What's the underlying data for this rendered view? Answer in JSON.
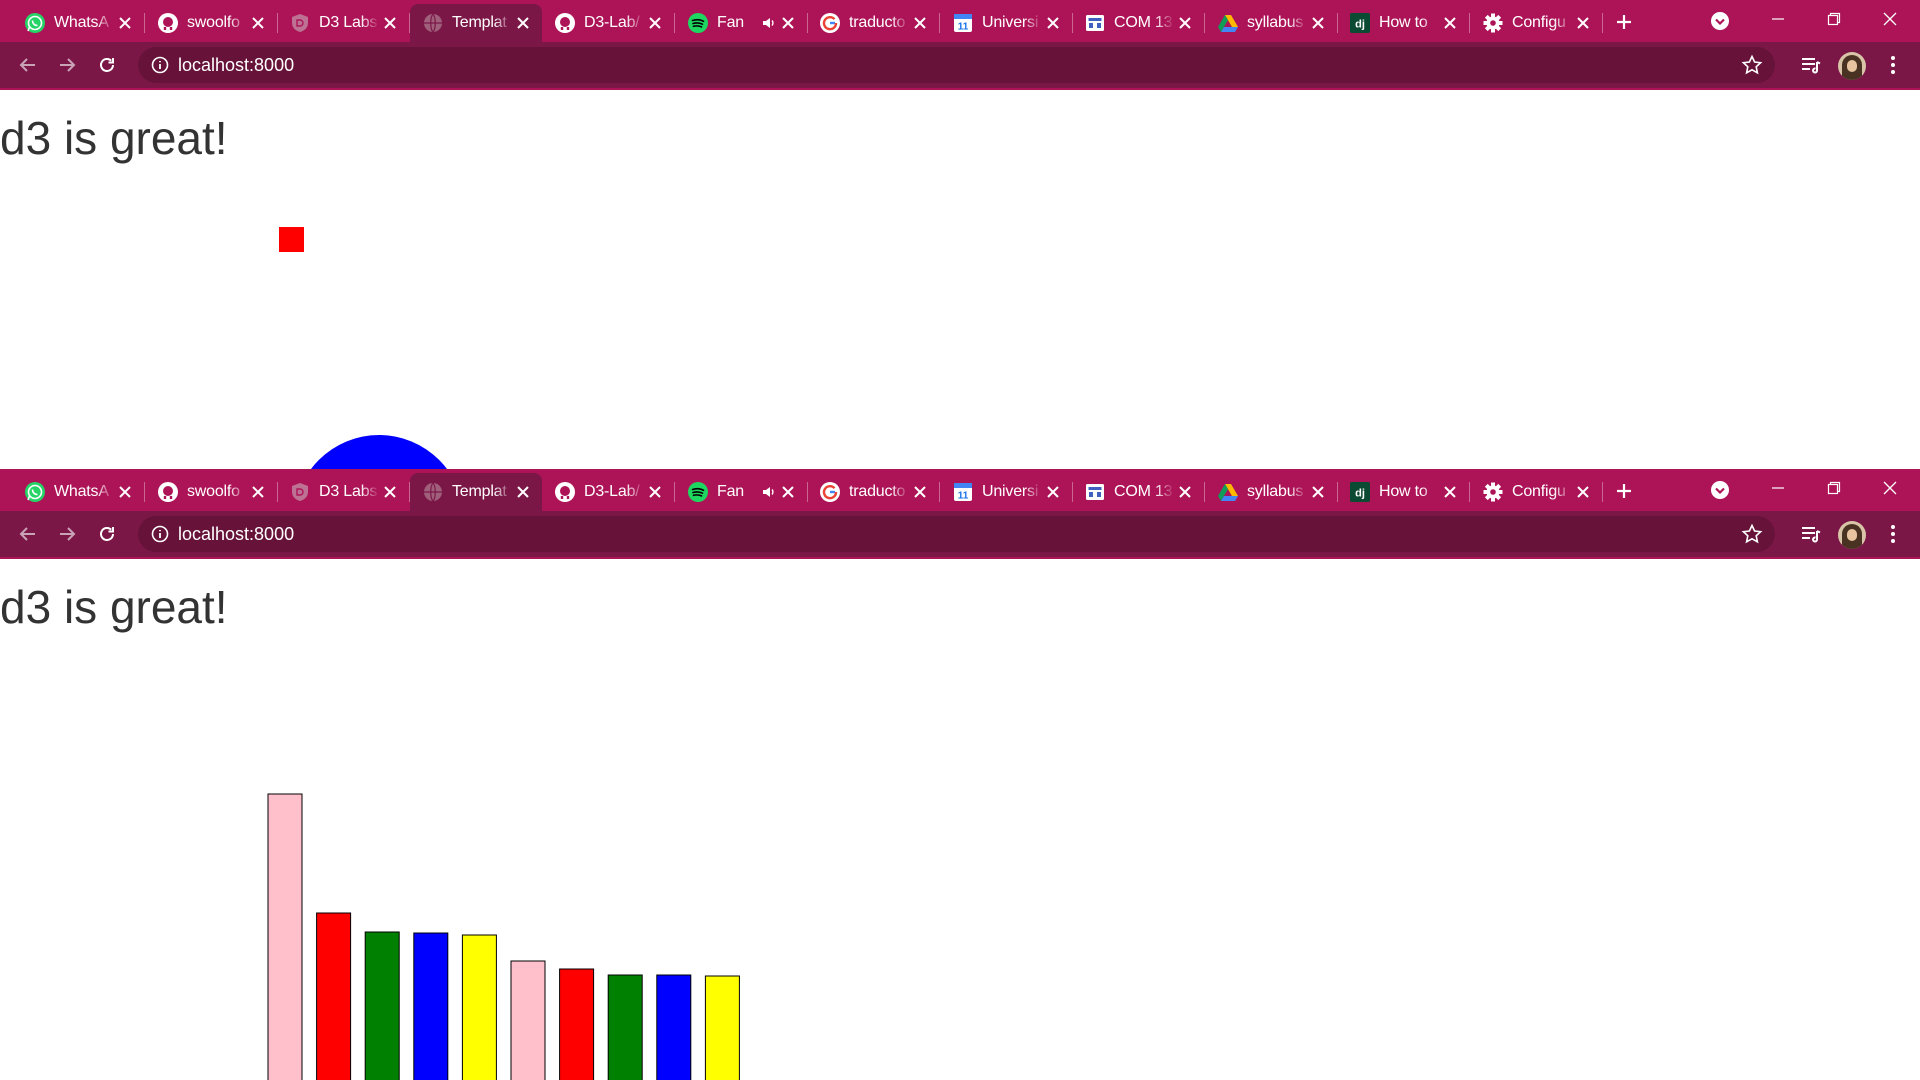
{
  "colors": {
    "tab_strip": "#ad1457",
    "toolbar": "#7b1747",
    "omnibox": "#661239",
    "page_bg": "#ffffff",
    "heading_text": "#333333"
  },
  "browser": {
    "tabs": [
      {
        "title": "WhatsA",
        "icon": "whatsapp-icon",
        "active": false
      },
      {
        "title": "swoolfo",
        "icon": "github-icon",
        "active": false
      },
      {
        "title": "D3 Labs",
        "icon": "d3-shield-icon",
        "active": false
      },
      {
        "title": "Templat",
        "icon": "globe-icon",
        "active": true
      },
      {
        "title": "D3-Lab/",
        "icon": "github-icon",
        "active": false
      },
      {
        "title": "Fan",
        "icon": "spotify-icon",
        "active": false,
        "audio": true
      },
      {
        "title": "traducto",
        "icon": "google-icon",
        "active": false
      },
      {
        "title": "Universi",
        "icon": "calendar-icon",
        "active": false
      },
      {
        "title": "COM 13",
        "icon": "classroom-icon",
        "active": false
      },
      {
        "title": "syllabus",
        "icon": "google-drive-icon",
        "active": false
      },
      {
        "title": "How to",
        "icon": "django-icon",
        "active": false
      },
      {
        "title": "Configu",
        "icon": "settings-gear-icon",
        "active": false
      }
    ],
    "url": "localhost:8000"
  },
  "page": {
    "heading": "d3 is great!"
  },
  "shapes": {
    "square_color": "#ff0000",
    "circle_color": "#0000ff"
  },
  "chart_data": {
    "type": "bar",
    "title": "",
    "xlabel": "",
    "ylabel": "",
    "values": [
      287,
      168,
      149,
      148,
      146,
      120,
      112,
      106,
      106,
      105
    ],
    "colors": [
      "#ffc0cb",
      "#ff0000",
      "#008000",
      "#0000ff",
      "#ffff00",
      "#ffc0cb",
      "#ff0000",
      "#008000",
      "#0000ff",
      "#ffff00"
    ],
    "bar_stroke": "#000000",
    "axes_shown": false,
    "grid": false
  }
}
